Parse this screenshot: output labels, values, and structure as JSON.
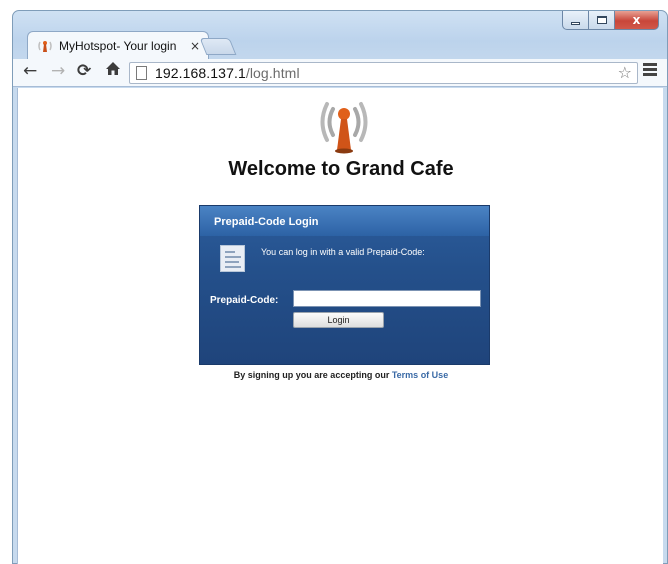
{
  "browser": {
    "tab_title": "MyHotspot- Your login",
    "tab_close": "×",
    "url_host": "192.168.137.1",
    "url_path": "/log.html",
    "icons": {
      "back": "back-arrow-icon",
      "forward": "forward-arrow-icon",
      "reload": "reload-icon",
      "home": "home-icon",
      "page": "page-icon",
      "bookmark": "star-icon",
      "menu": "menu-icon"
    },
    "window_close": "x"
  },
  "page": {
    "title": "Welcome to Grand Cafe",
    "logo_icon": "wifi-antenna-logo",
    "panel": {
      "header": "Prepaid-Code Login",
      "info_text": "You can log in with a valid Prepaid-Code:",
      "code_label": "Prepaid-Code:",
      "code_value": "",
      "login_button": "Login"
    },
    "terms_text": "By signing up you are accepting our",
    "terms_link": "Terms of Use"
  },
  "colors": {
    "panel_blue": "#24508b",
    "panel_header_blue": "#3a73b8",
    "link_blue": "#3a6aa6",
    "logo_orange": "#e0601a"
  }
}
